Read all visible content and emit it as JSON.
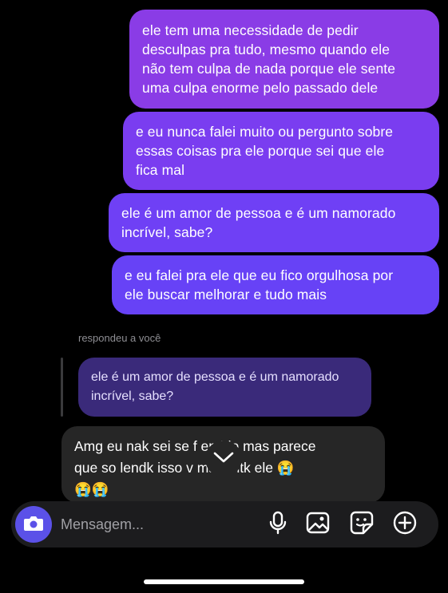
{
  "messages": {
    "outgoing": [
      {
        "text": "ele tem uma necessidade de pedir\ndesculpas pra tudo, mesmo quando ele\nnão tem culpa de nada porque ele sente\numa culpa enorme pelo passado dele"
      },
      {
        "text": "e eu nunca falei muito ou pergunto sobre\nessas coisas pra ele porque sei que ele\nfica mal"
      },
      {
        "text": "ele é um amor de pessoa e é um namorado\nincrível, sabe?"
      },
      {
        "text": "e eu falei pra ele que eu fico orgulhosa por\nele buscar melhorar e tudo mais"
      }
    ],
    "reply_label": "respondeu a você",
    "quoted_text": "ele é um amor de pessoa e é um namorado\nincrível, sabe?",
    "incoming_text": "Amg eu nak sei se f      entido mas parece\nque so lendk isso v        ma tantk ele 😭\n😭😭"
  },
  "composer": {
    "placeholder": "Mensagem...",
    "icons": [
      "camera-icon",
      "microphone-icon",
      "image-icon",
      "sticker-icon",
      "plus-circle-icon"
    ]
  },
  "colors": {
    "background": "#000000",
    "bubble_gradient": [
      "#8a3ce6",
      "#7a3df0",
      "#6f40f5",
      "#6742f6"
    ],
    "quote_bubble": "#3a2a7a",
    "incoming_bubble": "#262626",
    "camera_button": "#5b51e8"
  }
}
